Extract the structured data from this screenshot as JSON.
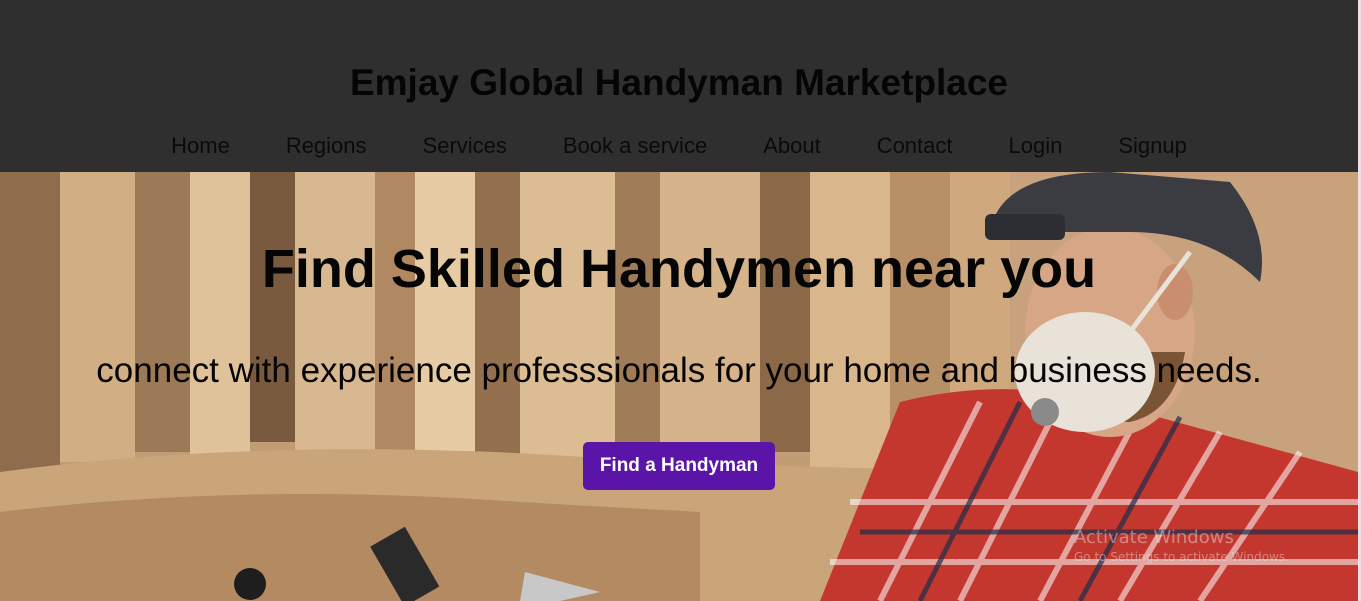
{
  "header": {
    "title": "Emjay Global Handyman Marketplace",
    "nav": [
      {
        "label": "Home"
      },
      {
        "label": "Regions"
      },
      {
        "label": "Services"
      },
      {
        "label": "Book a service"
      },
      {
        "label": "About"
      },
      {
        "label": "Contact"
      },
      {
        "label": "Login"
      },
      {
        "label": "Signup"
      }
    ]
  },
  "hero": {
    "title": "Find Skilled Handymen near you",
    "subtitle": "connect with experience professsionals for your home and business needs.",
    "cta_label": "Find a Handyman"
  },
  "watermark": {
    "title": "Activate Windows",
    "subtitle": "Go to Settings to activate Windows."
  },
  "colors": {
    "header_bg": "#2f2f2f",
    "cta_bg": "#5a14a8",
    "cta_text": "#ffffff"
  }
}
